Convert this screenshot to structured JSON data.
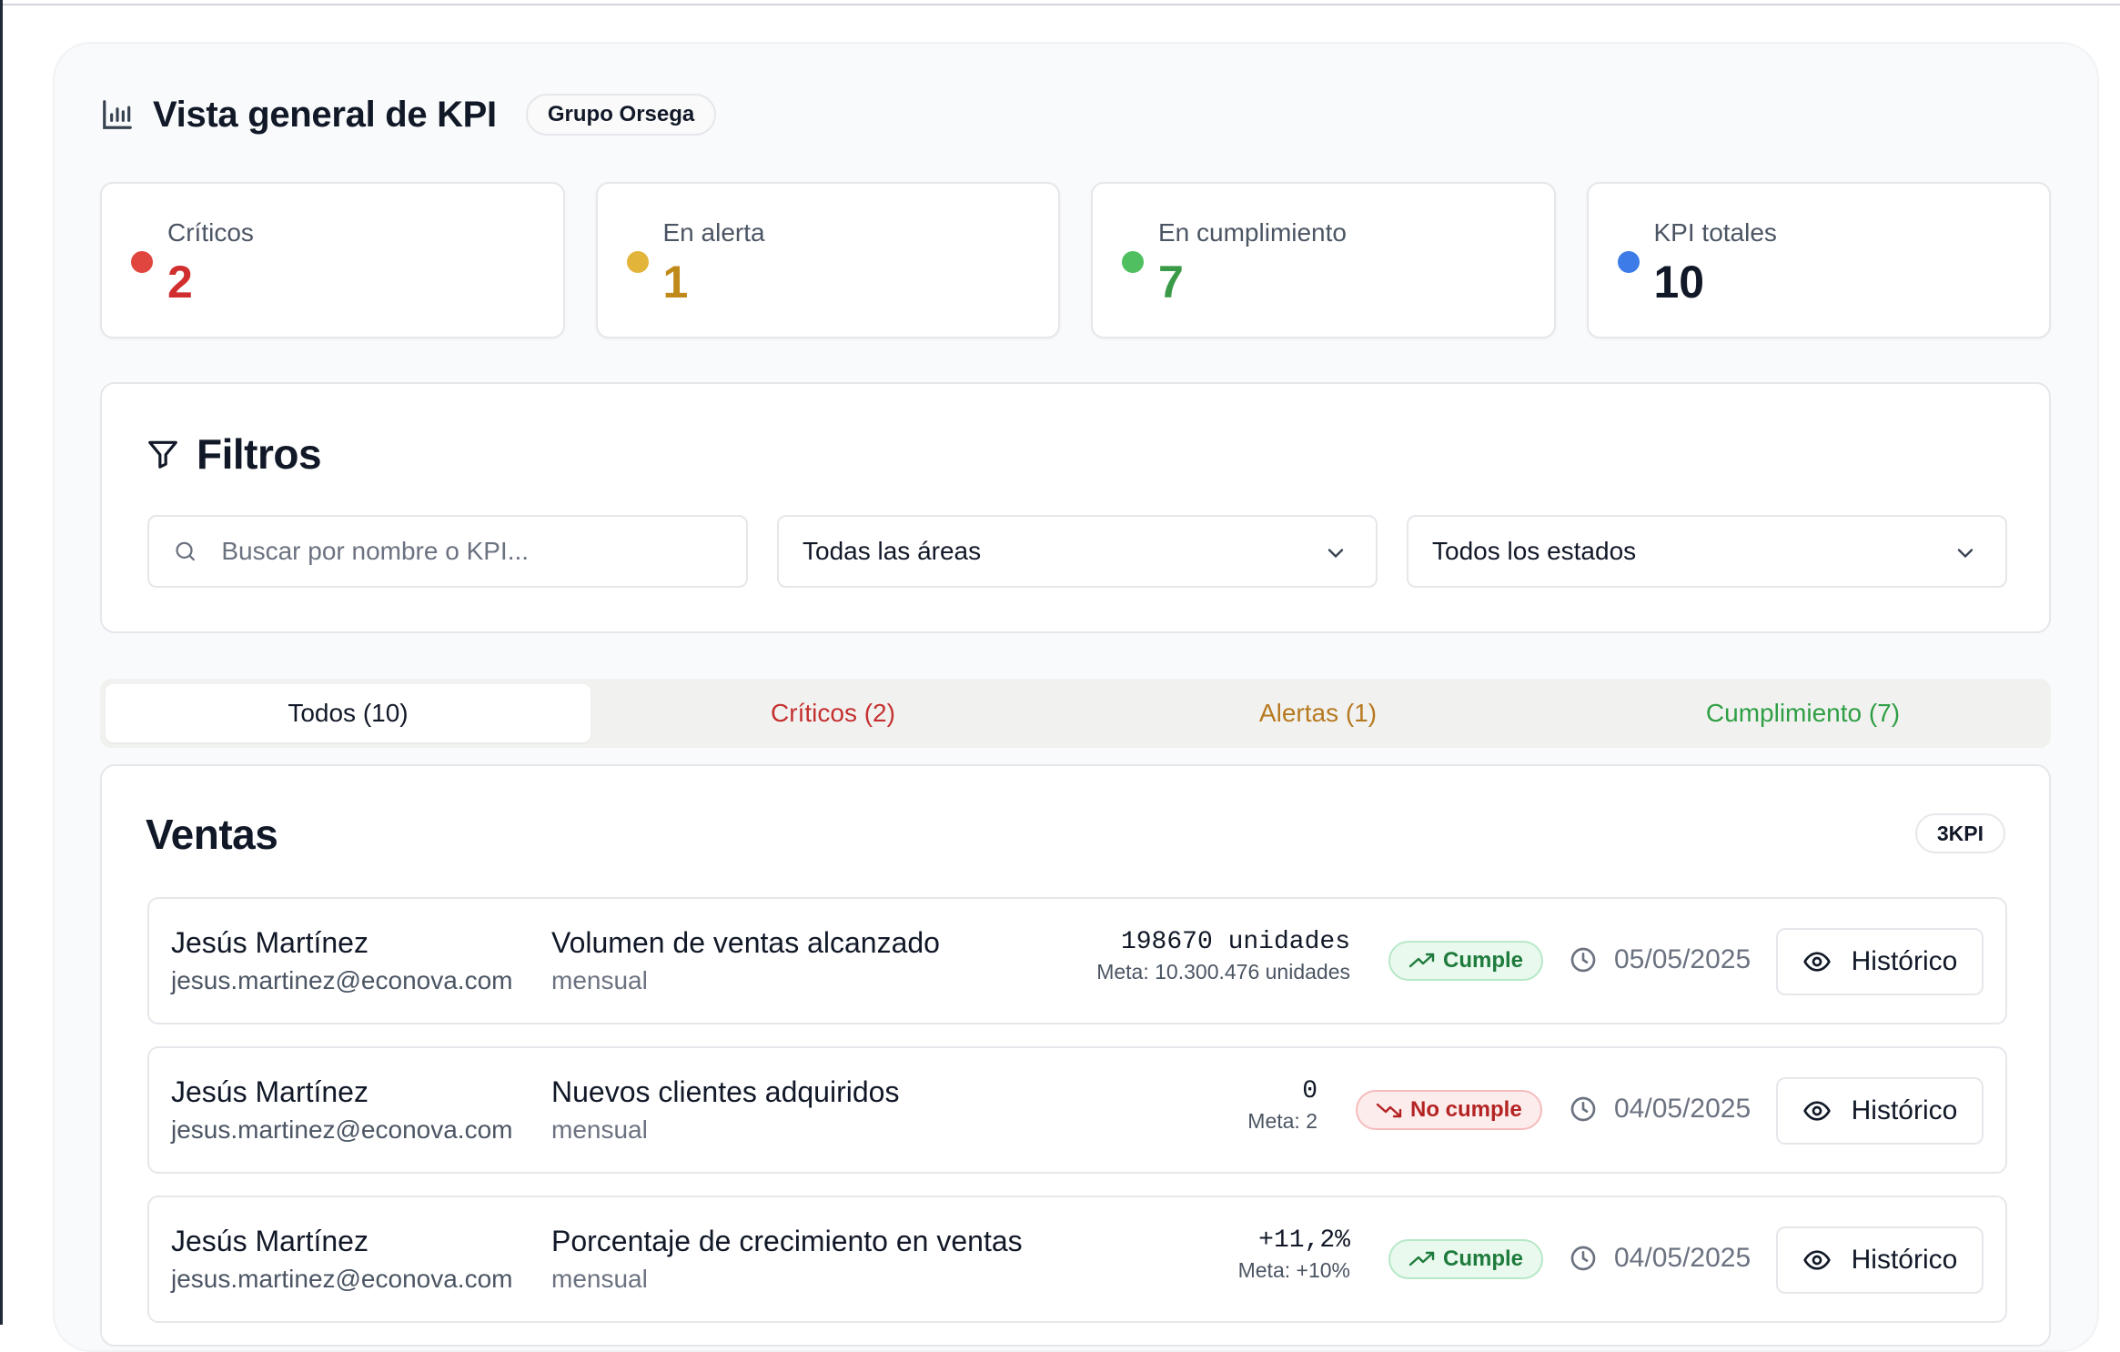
{
  "header": {
    "title": "Vista general de KPI",
    "org": "Grupo Orsega"
  },
  "stats": [
    {
      "label": "Críticos",
      "value": "2",
      "color": "#e0463e",
      "value_color": "#d12f2f"
    },
    {
      "label": "En alerta",
      "value": "1",
      "color": "#e3b43a",
      "value_color": "#c08a1a"
    },
    {
      "label": "En cumplimiento",
      "value": "7",
      "color": "#4fbf5f",
      "value_color": "#3a9a47"
    },
    {
      "label": "KPI totales",
      "value": "10",
      "color": "#3d7be8",
      "value_color": "#111827"
    }
  ],
  "filters": {
    "title": "Filtros",
    "search_placeholder": "Buscar por nombre o KPI...",
    "area_value": "Todas las áreas",
    "status_value": "Todos los estados"
  },
  "tabs": [
    {
      "label": "Todos (10)"
    },
    {
      "label": "Críticos (2)"
    },
    {
      "label": "Alertas (1)"
    },
    {
      "label": "Cumplimiento (7)"
    }
  ],
  "section": {
    "title": "Ventas",
    "badge": "3KPI",
    "rows": [
      {
        "name": "Jesús Martínez",
        "email": "jesus.martinez@econova.com",
        "kpi": "Volumen de ventas alcanzado",
        "frequency": "mensual",
        "value": "198670 unidades",
        "meta": "Meta: 10.300.476 unidades",
        "status": "Cumple",
        "status_kind": "ok",
        "date": "05/05/2025",
        "action": "Histórico"
      },
      {
        "name": "Jesús Martínez",
        "email": "jesus.martinez@econova.com",
        "kpi": "Nuevos clientes adquiridos",
        "frequency": "mensual",
        "value": "0",
        "meta": "Meta: 2",
        "status": "No cumple",
        "status_kind": "bad",
        "date": "04/05/2025",
        "action": "Histórico"
      },
      {
        "name": "Jesús Martínez",
        "email": "jesus.martinez@econova.com",
        "kpi": "Porcentaje de crecimiento en ventas",
        "frequency": "mensual",
        "value": "+11,2%",
        "meta": "Meta: +10%",
        "status": "Cumple",
        "status_kind": "ok",
        "date": "04/05/2025",
        "action": "Histórico"
      }
    ]
  }
}
